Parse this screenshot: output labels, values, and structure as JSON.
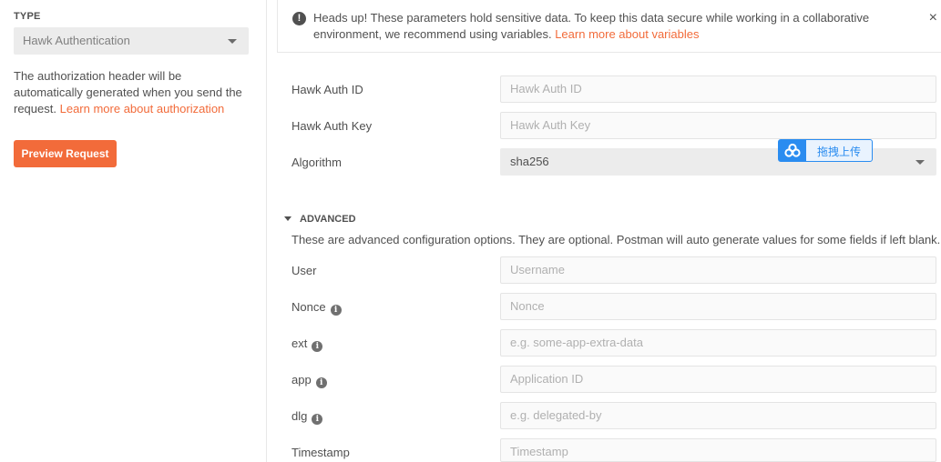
{
  "auth": {
    "type_label": "TYPE",
    "type_value": "Hawk Authentication",
    "description": "The authorization header will be automatically generated when you send the request.",
    "learn_more": "Learn more about authorization",
    "preview_button": "Preview Request"
  },
  "alert": {
    "text": "Heads up! These parameters hold sensitive data. To keep this data secure while working in a collaborative environment, we recommend using variables.",
    "link": "Learn more about variables",
    "close": "×"
  },
  "fields": {
    "hawk_id": {
      "label": "Hawk Auth ID",
      "placeholder": "Hawk Auth ID"
    },
    "hawk_key": {
      "label": "Hawk Auth Key",
      "placeholder": "Hawk Auth Key"
    },
    "algorithm": {
      "label": "Algorithm",
      "value": "sha256"
    }
  },
  "advanced": {
    "title": "ADVANCED",
    "description": "These are advanced configuration options. They are optional. Postman will auto generate values for some fields if left blank.",
    "rows": {
      "user": {
        "label": "User",
        "placeholder": "Username"
      },
      "nonce": {
        "label": "Nonce",
        "placeholder": "Nonce"
      },
      "ext": {
        "label": "ext",
        "placeholder": "e.g. some-app-extra-data"
      },
      "app": {
        "label": "app",
        "placeholder": "Application ID"
      },
      "dlg": {
        "label": "dlg",
        "placeholder": "e.g. delegated-by"
      },
      "timestamp": {
        "label": "Timestamp",
        "placeholder": "Timestamp"
      }
    }
  },
  "upload_widget": {
    "label": "拖拽上传"
  },
  "icons": {
    "info": "info-icon",
    "alert": "exclamation-icon",
    "cloud": "cloud-upload-icon"
  },
  "colors": {
    "accent": "#f26b3a",
    "upload_blue": "#2a8cf0"
  }
}
